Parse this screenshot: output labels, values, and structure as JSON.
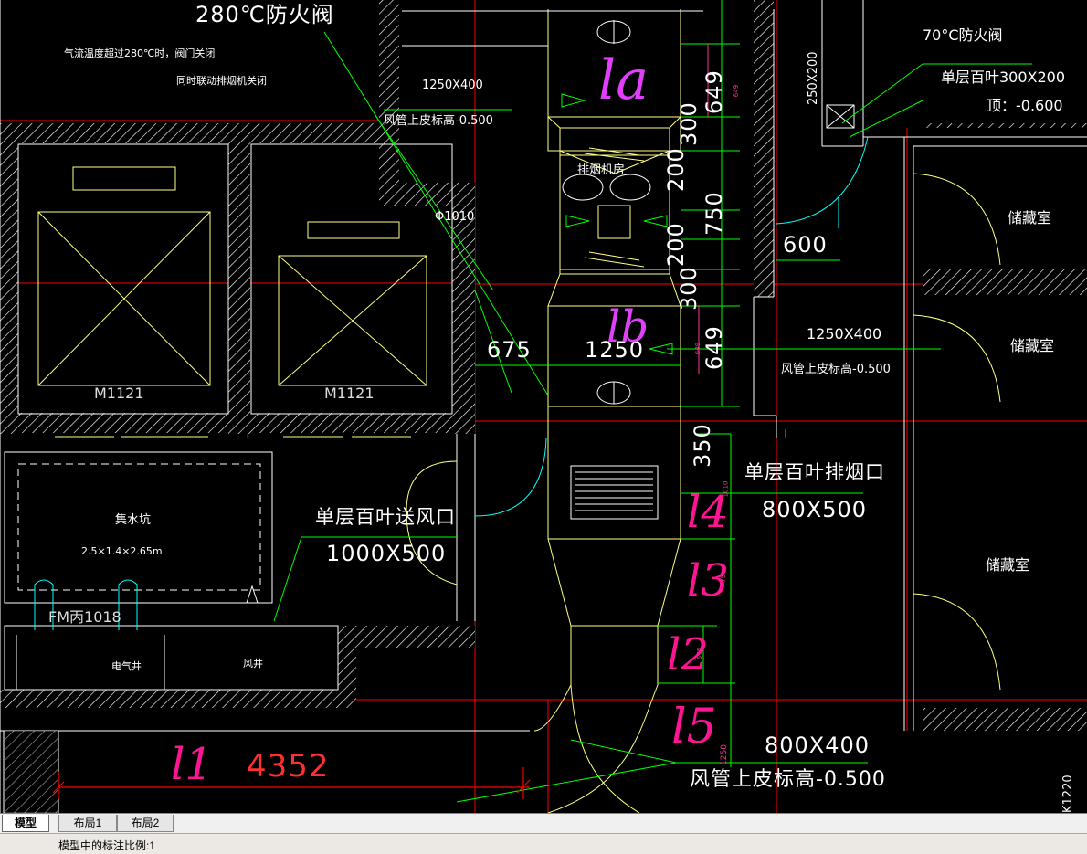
{
  "drawing": {
    "fire_damper_280": "280℃防火阀",
    "note_line1": "气流温度超过280℃时，阀门关闭",
    "note_line2": "同时联动排烟机关闭",
    "duct_1250x400_top": "1250X400",
    "duct_elev_top": "风管上皮标高-0.500",
    "fire_damper_70": "70°C防火阀",
    "louver_300x200": "单层百叶300X200",
    "louver_top_elev": "顶：-0.600",
    "vertical_250x200": "250X200",
    "dim_600": "600",
    "fan_room": "排烟机房",
    "phi_1010": "Φ1010",
    "dim_649_top": "649",
    "dim_300_a": "300",
    "dim_200_a": "200",
    "dim_750": "750",
    "dim_200_b": "200",
    "dim_300_b": "300",
    "dim_649_bottom": "649",
    "dim_675": "675",
    "dim_1250": "1250",
    "duct_1250x400_right": "1250X400",
    "duct_elev_right": "风管上皮标高-0.500",
    "storage_1": "储藏室",
    "storage_2": "储藏室",
    "storage_3": "储藏室",
    "elevator_left": "M1121",
    "elevator_right": "M1121",
    "dim_350": "350",
    "smoke_louver": "单层百叶排烟口",
    "smoke_louver_size": "800X500",
    "supply_louver": "单层百叶送风口",
    "supply_louver_size": "1000X500",
    "sump": "集水坑",
    "sump_size": "2.5×1.4×2.65m",
    "door_fm": "FM丙1018",
    "electrical_shaft": "电气井",
    "air_shaft": "风井",
    "duct_800x400": "800X400",
    "duct_elev_bottom": "风管上皮标高-0.500",
    "dim_4352": "4352",
    "tag_k1220": "K1220",
    "small_dim_649a": "649",
    "small_dim_649b": "649",
    "small_dim_1010": "1010",
    "small_dim_775": "775",
    "small_dim_575": "575",
    "small_dim_1250": "1250"
  },
  "handwritten": {
    "la": "la",
    "lb": "lb",
    "l4": "l4",
    "l3": "l3",
    "l2": "l2",
    "l5": "l5",
    "l1": "l1"
  },
  "tabs": [
    {
      "label": "模型",
      "active": true
    },
    {
      "label": "布局1",
      "active": false
    },
    {
      "label": "布局2",
      "active": false
    }
  ],
  "status": {
    "text": "模型中的标注比例:1"
  },
  "colors": {
    "background": "#000000",
    "wall": "#ffffff",
    "duct": "#ffff80",
    "dimension": "#00ff00",
    "centerline": "#ff0000",
    "leader": "#00ff00",
    "door_arc": "#00ffff",
    "hand_purple": "#e040fb",
    "hand_magenta": "#ff1493"
  }
}
